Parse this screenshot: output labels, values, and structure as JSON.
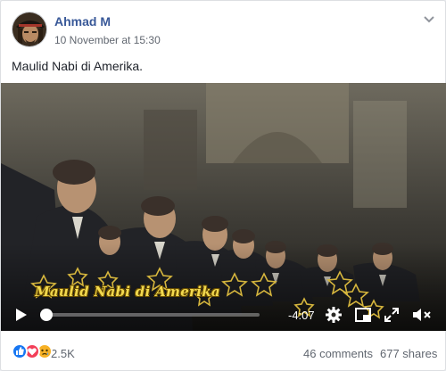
{
  "post": {
    "author": "Ahmad M",
    "timestamp": "10 November at 15:30",
    "text": "Maulid Nabi di Amerika."
  },
  "video": {
    "caption": "Maulid Nabi di Amerika",
    "time_remaining": "-4:07",
    "progress": 0.03
  },
  "footer": {
    "reaction_icons": [
      "like-icon",
      "love-icon",
      "sad-icon"
    ],
    "reaction_count": "2.5K",
    "comments": "46 comments",
    "shares": "677 shares"
  },
  "colors": {
    "author_link": "#385898",
    "like": "#1877f2",
    "love": "#f33e58",
    "sad": "#f7b125",
    "caption": "#f2d94f"
  }
}
